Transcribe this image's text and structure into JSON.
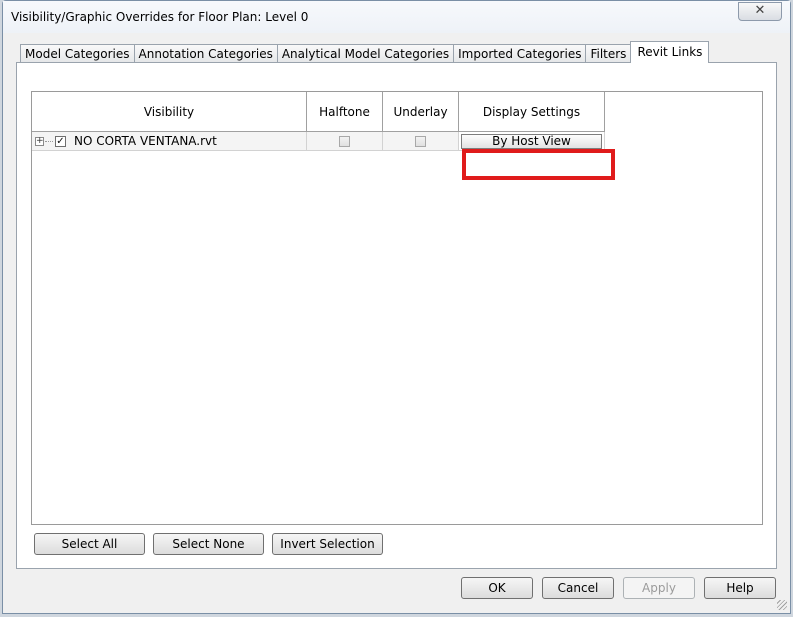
{
  "window": {
    "title": "Visibility/Graphic Overrides for Floor Plan: Level 0",
    "close_glyph": "✕"
  },
  "tabs": [
    {
      "label": "Model Categories",
      "active": false
    },
    {
      "label": "Annotation Categories",
      "active": false
    },
    {
      "label": "Analytical Model Categories",
      "active": false
    },
    {
      "label": "Imported Categories",
      "active": false
    },
    {
      "label": "Filters",
      "active": false
    },
    {
      "label": "Revit Links",
      "active": true
    }
  ],
  "table": {
    "columns": [
      "Visibility",
      "Halftone",
      "Underlay",
      "Display Settings"
    ],
    "rows": [
      {
        "expander": "+",
        "visible": true,
        "name": "NO CORTA VENTANA.rvt",
        "halftone": false,
        "underlay": false,
        "display_settings": "By Host View"
      }
    ]
  },
  "selection_buttons": {
    "select_all": "Select All",
    "select_none": "Select None",
    "invert_selection": "Invert Selection"
  },
  "footer_buttons": {
    "ok": "OK",
    "cancel": "Cancel",
    "apply": "Apply",
    "help": "Help"
  },
  "highlight_color": "#e01b1b"
}
